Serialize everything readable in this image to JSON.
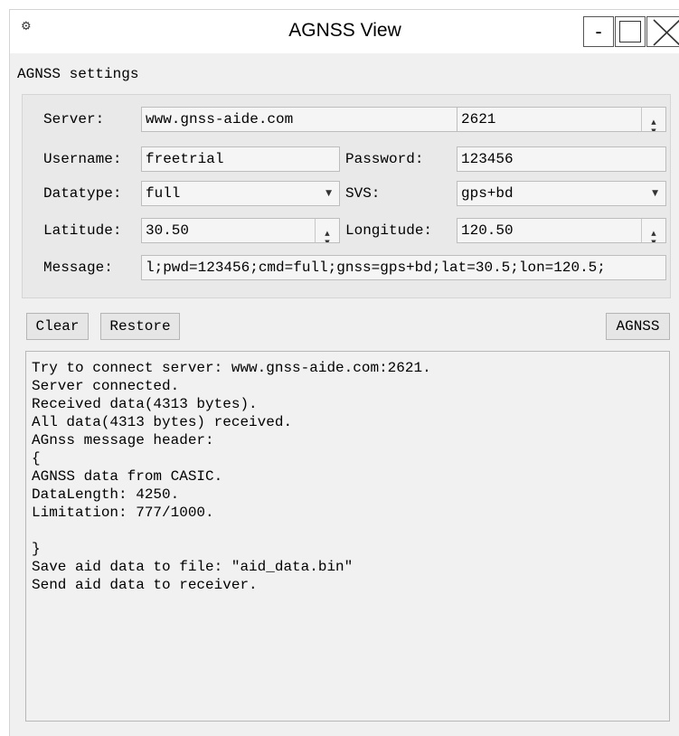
{
  "window": {
    "title": "AGNSS View",
    "minimize_label": "-",
    "app_icon": "satellite-icon"
  },
  "settings": {
    "group_title": "AGNSS settings",
    "server_label": "Server:",
    "server_value": "www.gnss-aide.com",
    "port_value": "2621",
    "username_label": "Username:",
    "username_value": "freetrial",
    "password_label": "Password:",
    "password_value": "123456",
    "datatype_label": "Datatype:",
    "datatype_value": "full",
    "svs_label": "SVS:",
    "svs_value": "gps+bd",
    "latitude_label": "Latitude:",
    "latitude_value": "30.50",
    "longitude_label": "Longitude:",
    "longitude_value": "120.50",
    "message_label": "Message:",
    "message_value": "l;pwd=123456;cmd=full;gnss=gps+bd;lat=30.5;lon=120.5;"
  },
  "buttons": {
    "clear": "Clear",
    "restore": "Restore",
    "agnss": "AGNSS"
  },
  "log": {
    "lines": [
      "Try to connect server: www.gnss-aide.com:2621.",
      "Server connected.",
      "Received data(4313 bytes).",
      "All data(4313 bytes) received.",
      "AGnss message header:",
      "{",
      "AGNSS data from CASIC.",
      "DataLength: 4250.",
      "Limitation: 777/1000.",
      "",
      "}",
      "Save aid data to file: \"aid_data.bin\"",
      "Send aid data to receiver."
    ]
  }
}
